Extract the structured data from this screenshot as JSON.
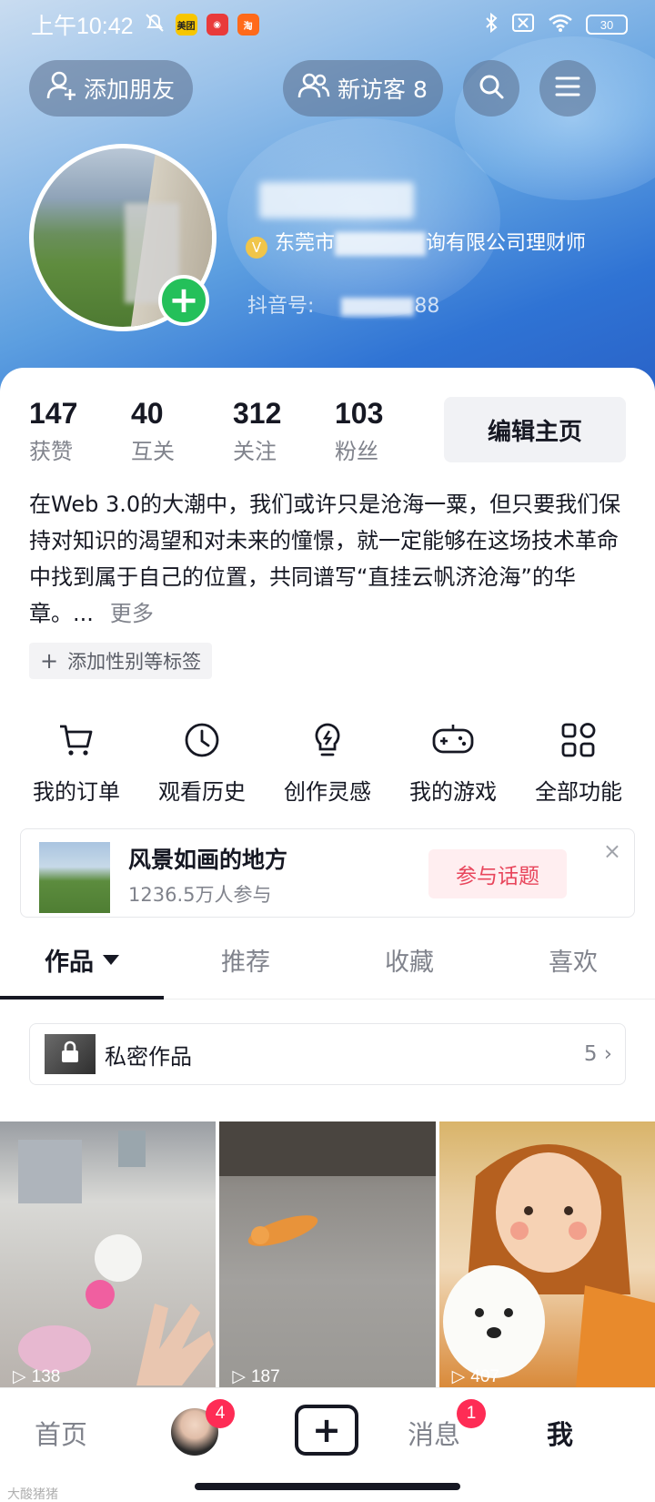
{
  "status_bar": {
    "time": "上午10:42",
    "apps": [
      {
        "label": "美团",
        "color": "#f7c600"
      },
      {
        "label": "网易",
        "color": "#e93a3a"
      },
      {
        "label": "淘",
        "color": "#ff6a1a"
      }
    ],
    "battery": "30"
  },
  "header": {
    "add_friend_label": "添加朋友",
    "visitors_label": "新访客 8"
  },
  "profile": {
    "verify_prefix": "东莞市",
    "verify_suffix": "询有限公司理财师",
    "douyin_id_label": "抖音号:",
    "douyin_id_tail": "88"
  },
  "stats": [
    {
      "num": "147",
      "label": "获赞"
    },
    {
      "num": "40",
      "label": "互关"
    },
    {
      "num": "312",
      "label": "关注"
    },
    {
      "num": "103",
      "label": "粉丝"
    }
  ],
  "edit_button": "编辑主页",
  "bio": {
    "text": "在Web 3.0的大潮中，我们或许只是沧海一粟，但只要我们保持对知识的渴望和对未来的憧憬，就一定能够在这场技术革命中找到属于自己的位置，共同谱写“直挂云帆济沧海”的华章。...",
    "more": "更多"
  },
  "tag_button": "添加性别等标签",
  "features": [
    {
      "label": "我的订单",
      "icon": "cart-icon"
    },
    {
      "label": "观看历史",
      "icon": "clock-icon"
    },
    {
      "label": "创作灵感",
      "icon": "bulb-icon"
    },
    {
      "label": "我的游戏",
      "icon": "gamepad-icon"
    },
    {
      "label": "全部功能",
      "icon": "grid-icon"
    }
  ],
  "topic": {
    "title": "风景如画的地方",
    "participants": "1236.5万人参与",
    "join": "参与话题",
    "close": "×"
  },
  "tabs": [
    {
      "label": "作品",
      "active": true
    },
    {
      "label": "推荐",
      "active": false
    },
    {
      "label": "收藏",
      "active": false
    },
    {
      "label": "喜欢",
      "active": false
    }
  ],
  "private_works": {
    "label": "私密作品",
    "count": "5 ›"
  },
  "videos": [
    {
      "plays": "138"
    },
    {
      "plays": "187"
    },
    {
      "plays": "407"
    }
  ],
  "bottom_nav": {
    "home": "首页",
    "friends_badge": "4",
    "messages": "消息",
    "messages_badge": "1",
    "me": "我"
  },
  "watermark": "大酸猪猪"
}
